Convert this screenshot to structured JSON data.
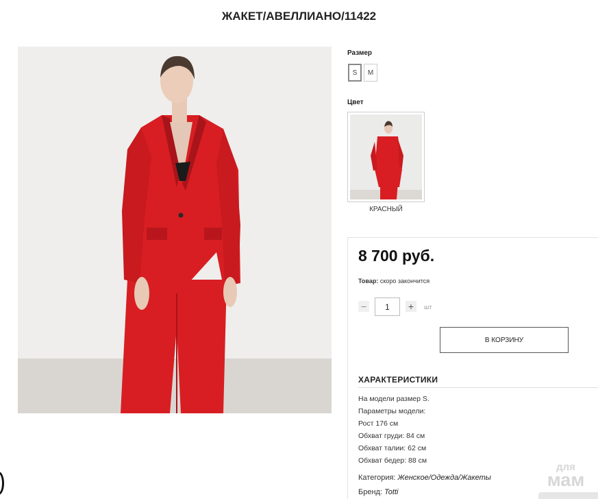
{
  "product": {
    "title": "ЖАКЕТ/АВЕЛЛИАНО/11422"
  },
  "size": {
    "label": "Размер",
    "options": [
      "S",
      "M"
    ],
    "selected": "S"
  },
  "color": {
    "label": "Цвет",
    "name": "КРАСНЫЙ",
    "swatch_color": "#d81e22"
  },
  "buy": {
    "price": "8 700 руб.",
    "stock_label": "Товар:",
    "stock_value": "скоро закончится",
    "qty_minus": "−",
    "qty_plus": "+",
    "qty_value": "1",
    "qty_unit": "шт",
    "cart_button": "В КОРЗИНУ"
  },
  "characteristics": {
    "title": "ХАРАКТЕРИСТИКИ",
    "lines": [
      "На модели размер S.",
      "Параметры модели:",
      "Рост 176 см",
      "Обхват груди: 84 см",
      "Обхват талии: 62 см",
      "Обхват бедер: 88 см"
    ],
    "category_label": "Категория:",
    "category_value": "Женское/Одежда/Жакеты",
    "brand_label": "Бренд:",
    "brand_value": "Totti"
  },
  "watermark": {
    "line1": "для",
    "line2": "мам"
  },
  "colors": {
    "suit_red": "#d81e22",
    "suit_shadow": "#a8141a",
    "background": "#ececea",
    "floor": "#d9d6d2"
  }
}
